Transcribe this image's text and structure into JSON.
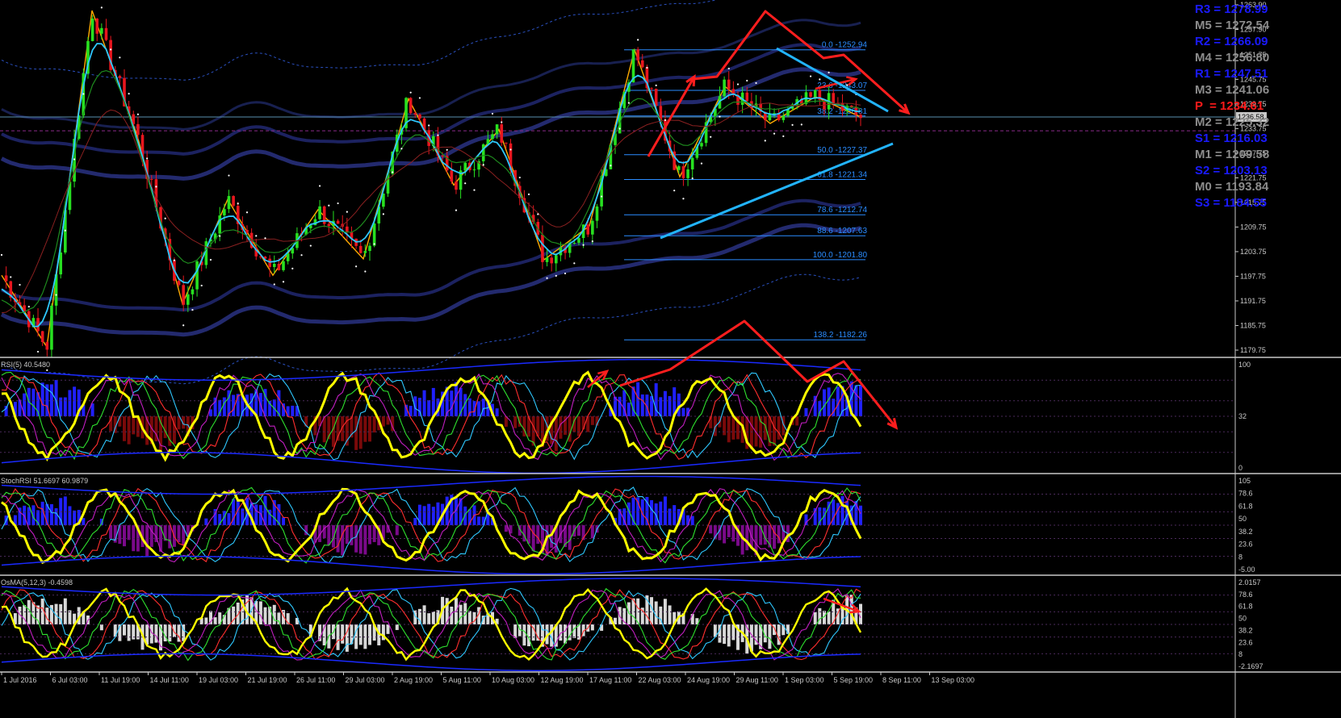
{
  "pivots": [
    {
      "label": "R3",
      "value": "1278.99",
      "color": "#1a1aff"
    },
    {
      "label": "M5",
      "value": "1272.54",
      "color": "#8c8c8c"
    },
    {
      "label": "R2",
      "value": "1266.09",
      "color": "#1a1aff"
    },
    {
      "label": "M4",
      "value": "1256.80",
      "color": "#8c8c8c"
    },
    {
      "label": "R1",
      "value": "1247.51",
      "color": "#1a1aff"
    },
    {
      "label": "M3",
      "value": "1241.06",
      "color": "#8c8c8c"
    },
    {
      "label": "P ",
      "value": "1234.61",
      "color": "#ff1a1a"
    },
    {
      "label": "M2",
      "value": "1225.32",
      "color": "#8c8c8c"
    },
    {
      "label": "S1",
      "value": "1216.03",
      "color": "#1a1aff"
    },
    {
      "label": "M1",
      "value": "1209.58",
      "color": "#8c8c8c"
    },
    {
      "label": "S2",
      "value": "1203.13",
      "color": "#1a1aff"
    },
    {
      "label": "M0",
      "value": "1193.84",
      "color": "#8c8c8c"
    },
    {
      "label": "S3",
      "value": "1184.55",
      "color": "#1a1aff"
    }
  ],
  "price_axis": {
    "ticks": [
      "1263.90",
      "1257.90",
      "1251.75",
      "1245.75",
      "1239.75",
      "1233.75",
      "1227.75",
      "1221.75",
      "1215.75",
      "1209.75",
      "1203.75",
      "1197.75",
      "1191.75",
      "1185.75",
      "1179.75"
    ],
    "current_price": "1236.58"
  },
  "fib_levels": [
    {
      "label": "0.0 -1252.94"
    },
    {
      "label": "23.6 -1243.07"
    },
    {
      "label": "38.2 -1236.81"
    },
    {
      "label": "50.0 -1227.37"
    },
    {
      "label": "61.8 -1221.34"
    },
    {
      "label": "78.6 -1212.74"
    },
    {
      "label": "88.6 -1207.63"
    },
    {
      "label": "100.0 -1201.80"
    },
    {
      "label": "138.2 -1182.26"
    }
  ],
  "panels": {
    "rsi": {
      "title": "RSI(5) 40.5480",
      "ticks": [
        "100",
        "32",
        "0"
      ]
    },
    "stoch": {
      "title": "StochRSI 51.6697 60.9879",
      "ticks": [
        "105",
        "78.6",
        "61.8",
        "50",
        "38.2",
        "23.6",
        "8",
        "-5.00"
      ]
    },
    "osma": {
      "title": "OsMA(5,12,3) -0.4598",
      "ticks": [
        "2.0157",
        "78.6",
        "61.8",
        "50",
        "38.2",
        "23.6",
        "8",
        "-2.1697"
      ]
    }
  },
  "time_axis": {
    "labels": [
      "1 Jul 2016",
      "6 Jul 03:00",
      "11 Jul 19:00",
      "14 Jul 11:00",
      "19 Jul 03:00",
      "21 Jul 19:00",
      "26 Jul 11:00",
      "29 Jul 03:00",
      "2 Aug 19:00",
      "5 Aug 11:00",
      "10 Aug 03:00",
      "12 Aug 19:00",
      "17 Aug 11:00",
      "22 Aug 03:00",
      "24 Aug 19:00",
      "29 Aug 11:00",
      "1 Sep 03:00",
      "5 Sep 19:00",
      "8 Sep 11:00",
      "13 Sep 03:00"
    ]
  },
  "chart_data": {
    "type": "line",
    "title": "",
    "instrument_hint": "",
    "price_ylim": [
      1179.75,
      1263.9
    ],
    "swing_points": [
      {
        "x": 0,
        "y": 1198.0
      },
      {
        "x": 1,
        "y": 1180.5
      },
      {
        "x": 2,
        "y": 1262.5
      },
      {
        "x": 3,
        "y": 1232.0
      },
      {
        "x": 4,
        "y": 1191.0
      },
      {
        "x": 5,
        "y": 1216.5
      },
      {
        "x": 6,
        "y": 1198.0
      },
      {
        "x": 7,
        "y": 1214.0
      },
      {
        "x": 8,
        "y": 1202.0
      },
      {
        "x": 9,
        "y": 1241.0
      },
      {
        "x": 10,
        "y": 1220.0
      },
      {
        "x": 11,
        "y": 1233.5
      },
      {
        "x": 12,
        "y": 1201.8
      },
      {
        "x": 13,
        "y": 1210.0
      },
      {
        "x": 14,
        "y": 1252.9
      },
      {
        "x": 15,
        "y": 1222.0
      },
      {
        "x": 16,
        "y": 1244.0
      },
      {
        "x": 17,
        "y": 1235.0
      },
      {
        "x": 18,
        "y": 1241.5
      },
      {
        "x": 19,
        "y": 1236.6
      }
    ],
    "pivot_levels": {
      "R3": 1278.99,
      "M5": 1272.54,
      "R2": 1266.09,
      "M4": 1256.8,
      "R1": 1247.51,
      "M3": 1241.06,
      "P": 1234.61,
      "M2": 1225.32,
      "S1": 1216.03,
      "M1": 1209.58,
      "S2": 1203.13,
      "M0": 1193.84,
      "S3": 1184.55
    },
    "fib_retracement": [
      {
        "level": 0.0,
        "price": 1252.94
      },
      {
        "level": 23.6,
        "price": 1243.07
      },
      {
        "level": 38.2,
        "price": 1236.81
      },
      {
        "level": 50.0,
        "price": 1227.37
      },
      {
        "level": 61.8,
        "price": 1221.34
      },
      {
        "level": 78.6,
        "price": 1212.74
      },
      {
        "level": 88.6,
        "price": 1207.63
      },
      {
        "level": 100.0,
        "price": 1201.8
      },
      {
        "level": 138.2,
        "price": 1182.26
      }
    ],
    "indicators": [
      {
        "name": "RSI(5)",
        "last": 40.548,
        "range": [
          0,
          100
        ]
      },
      {
        "name": "StochRSI",
        "last": [
          51.6697,
          60.9879
        ],
        "range": [
          -5,
          105
        ]
      },
      {
        "name": "OsMA(5,12,3)",
        "last": -0.4598,
        "range": [
          -2.1697,
          2.0157
        ]
      }
    ],
    "colors": {
      "bull": "#27e020",
      "bear": "#e8161e",
      "fast_ma": "#2ec8ff",
      "fib": "#2a8cff",
      "trend_arrow": "#ff1e1e",
      "channel": "#22b4ff",
      "zigzag": "#ffaa00",
      "osc": "#ffff00"
    }
  }
}
